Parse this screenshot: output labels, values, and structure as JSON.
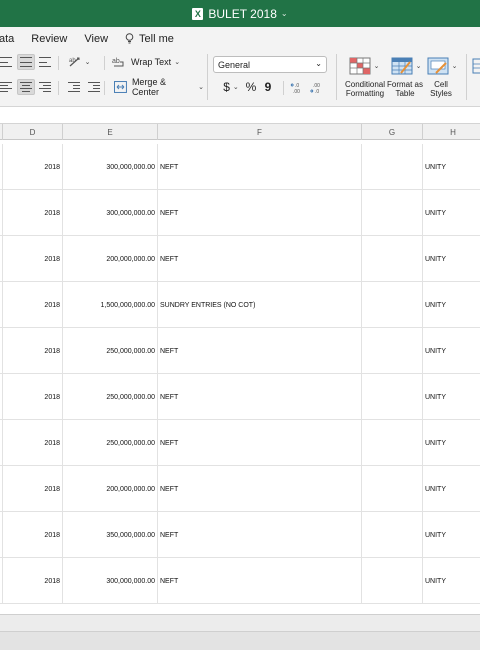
{
  "window": {
    "title": "BULET 2018",
    "title_caret": "⌄"
  },
  "ribbon_tabs": [
    "ata",
    "Review",
    "View"
  ],
  "tell_me": "Tell me",
  "ribbon": {
    "wrap_text": "Wrap Text",
    "merge_center": "Merge & Center",
    "number_format": "General",
    "currency_symbol": "$",
    "percent_symbol": "%",
    "comma_symbol": "9",
    "conditional_formatting": "Conditional Formatting",
    "format_as_table": "Format as Table",
    "cell_styles": "Cell Styles"
  },
  "columns": [
    "D",
    "E",
    "F",
    "G",
    "H"
  ],
  "rows": [
    {
      "year": "2018",
      "amount": "300,000,000.00",
      "description": "NEFT",
      "g": "",
      "h": "UNITY"
    },
    {
      "year": "2018",
      "amount": "300,000,000.00",
      "description": "NEFT",
      "g": "",
      "h": "UNITY"
    },
    {
      "year": "2018",
      "amount": "200,000,000.00",
      "description": "NEFT",
      "g": "",
      "h": "UNITY"
    },
    {
      "year": "2018",
      "amount": "1,500,000,000.00",
      "description": "SUNDRY ENTRIES (NO COT)",
      "g": "",
      "h": "UNITY"
    },
    {
      "year": "2018",
      "amount": "250,000,000.00",
      "description": "NEFT",
      "g": "",
      "h": "UNITY"
    },
    {
      "year": "2018",
      "amount": "250,000,000.00",
      "description": "NEFT",
      "g": "",
      "h": "UNITY"
    },
    {
      "year": "2018",
      "amount": "250,000,000.00",
      "description": "NEFT",
      "g": "",
      "h": "UNITY"
    },
    {
      "year": "2018",
      "amount": "200,000,000.00",
      "description": "NEFT",
      "g": "",
      "h": "UNITY"
    },
    {
      "year": "2018",
      "amount": "350,000,000.00",
      "description": "NEFT",
      "g": "",
      "h": "UNITY"
    },
    {
      "year": "2018",
      "amount": "300,000,000.00",
      "description": "NEFT",
      "g": "",
      "h": "UNITY"
    }
  ],
  "colors": {
    "title_bar": "#217346",
    "ribbon_bg": "#f3f3f3"
  }
}
